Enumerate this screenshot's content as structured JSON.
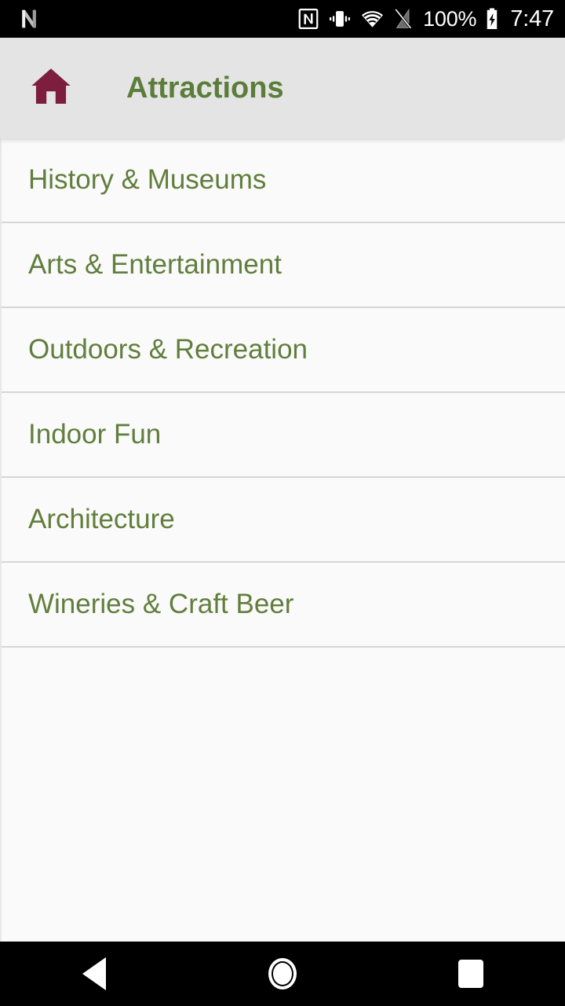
{
  "status_bar": {
    "notification_icon": "android-n-logo-icon",
    "icons": [
      {
        "name": "nfc-icon",
        "label": "NFC"
      },
      {
        "name": "vibrate-icon",
        "label": "Vibrate"
      },
      {
        "name": "wifi-icon",
        "label": "Wi-Fi"
      },
      {
        "name": "no-sim-signal-icon",
        "label": "No SIM"
      }
    ],
    "battery_percent": "100%",
    "battery_icon": "battery-charging-icon",
    "clock": "7:47"
  },
  "app_bar": {
    "home_icon": "home-icon",
    "title": "Attractions",
    "background_color": "#E4E4E4",
    "title_color": "#5B7D3A",
    "home_icon_color": "#7D1E3F"
  },
  "list": {
    "background_color": "#FAFAFA",
    "item_text_color": "#617E3D",
    "divider_color": "#D6D6D6",
    "items": [
      {
        "label": "History & Museums"
      },
      {
        "label": "Arts & Entertainment"
      },
      {
        "label": "Outdoors & Recreation"
      },
      {
        "label": "Indoor Fun"
      },
      {
        "label": "Architecture"
      },
      {
        "label": "Wineries & Craft Beer"
      }
    ]
  },
  "nav_bar": {
    "background_color": "#000000",
    "buttons": [
      {
        "name": "back",
        "icon": "triangle-back-icon"
      },
      {
        "name": "home",
        "icon": "circle-home-icon"
      },
      {
        "name": "recents",
        "icon": "square-recents-icon"
      }
    ]
  }
}
